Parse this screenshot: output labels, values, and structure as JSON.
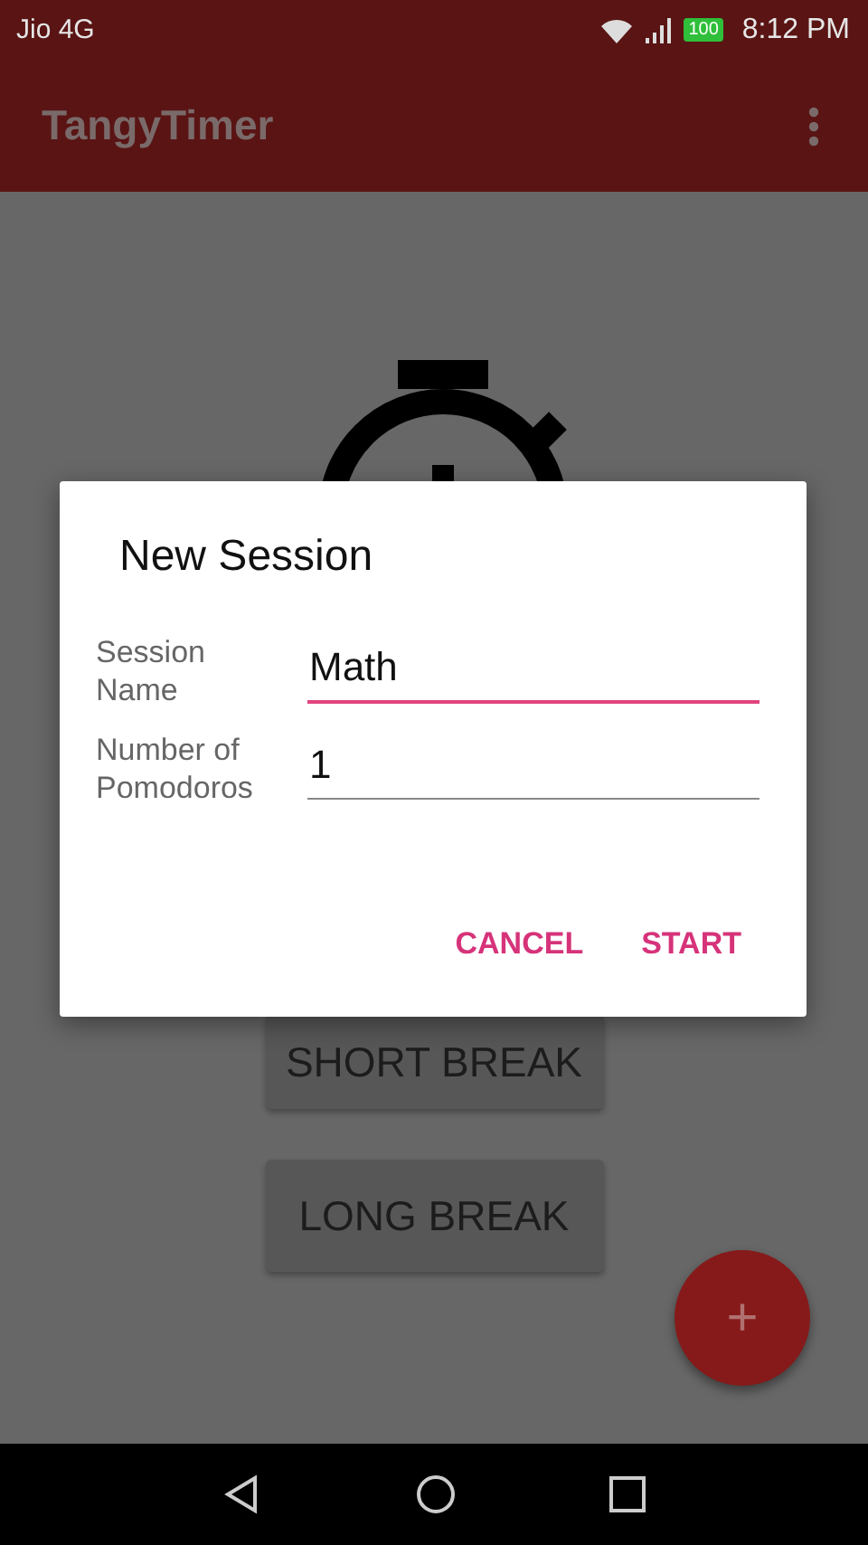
{
  "status_bar": {
    "carrier": "Jio 4G",
    "battery": "100",
    "time": "8:12 PM"
  },
  "app_bar": {
    "title": "TangyTimer"
  },
  "buttons": [
    "SHORT BREAK",
    "LONG BREAK"
  ],
  "dialog": {
    "title": "New Session",
    "fields": [
      {
        "label": "Session Name",
        "value": "Math",
        "focused": true
      },
      {
        "label": "Number of Pomodoros",
        "value": "1",
        "focused": false
      }
    ],
    "actions": [
      "CANCEL",
      "START"
    ]
  },
  "fab": {
    "label": "+"
  }
}
